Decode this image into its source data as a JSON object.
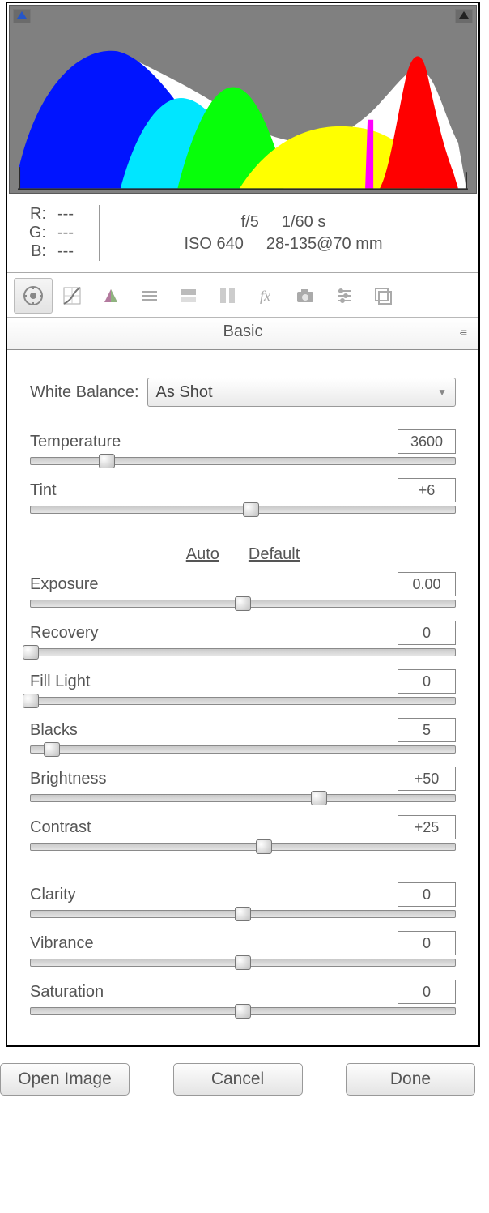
{
  "rgb": {
    "r_label": "R:",
    "g_label": "G:",
    "b_label": "B:",
    "r": "---",
    "g": "---",
    "b": "---"
  },
  "exif": {
    "aperture": "f/5",
    "shutter": "1/60 s",
    "iso": "ISO 640",
    "lens": "28-135@70 mm"
  },
  "panel_title": "Basic",
  "wb_label": "White Balance:",
  "wb_value": "As Shot",
  "auto_label": "Auto",
  "default_label": "Default",
  "sliders": {
    "temperature": {
      "label": "Temperature",
      "value": "3600",
      "pos": 18
    },
    "tint": {
      "label": "Tint",
      "value": "+6",
      "pos": 52
    },
    "exposure": {
      "label": "Exposure",
      "value": "0.00",
      "pos": 50
    },
    "recovery": {
      "label": "Recovery",
      "value": "0",
      "pos": 0
    },
    "fill": {
      "label": "Fill Light",
      "value": "0",
      "pos": 0
    },
    "blacks": {
      "label": "Blacks",
      "value": "5",
      "pos": 5
    },
    "brightness": {
      "label": "Brightness",
      "value": "+50",
      "pos": 68
    },
    "contrast": {
      "label": "Contrast",
      "value": "+25",
      "pos": 55
    },
    "clarity": {
      "label": "Clarity",
      "value": "0",
      "pos": 50
    },
    "vibrance": {
      "label": "Vibrance",
      "value": "0",
      "pos": 50
    },
    "saturation": {
      "label": "Saturation",
      "value": "0",
      "pos": 50
    }
  },
  "buttons": {
    "open": "Open Image",
    "cancel": "Cancel",
    "done": "Done"
  }
}
